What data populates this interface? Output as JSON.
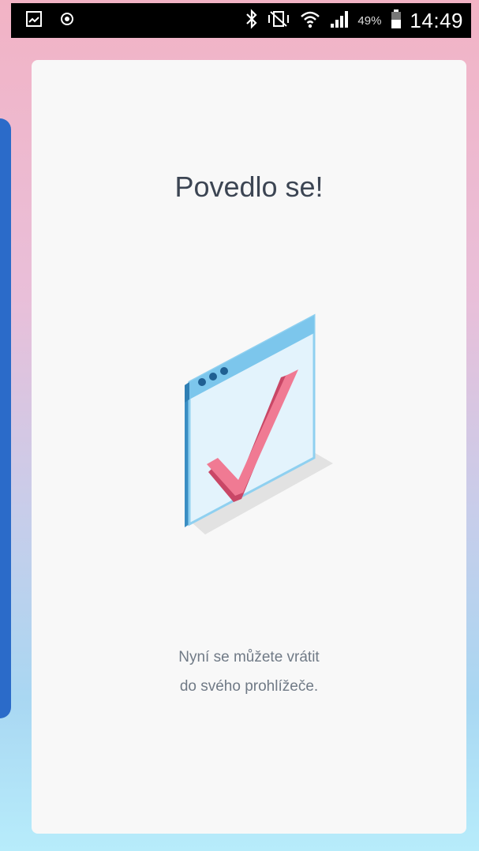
{
  "status_bar": {
    "battery_percent": "49%",
    "time": "14:49",
    "icons": [
      "image-icon",
      "shield-icon",
      "bluetooth-icon",
      "vibrate-icon",
      "wifi-icon",
      "signal-icon",
      "battery-icon"
    ]
  },
  "card": {
    "title": "Povedlo se!",
    "message_line1": "Nyní se můžete vrátit",
    "message_line2": "do svého prohlížeče."
  },
  "colors": {
    "accent_pink": "#ef6a86",
    "window_blue": "#7cc6ec",
    "sidebar_blue": "#2b6bc9"
  }
}
